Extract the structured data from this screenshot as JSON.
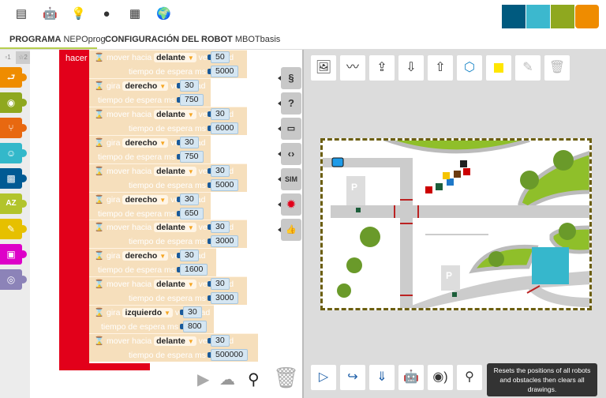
{
  "header": {
    "icons": [
      "program-list-icon",
      "robot-icon",
      "bulb-icon",
      "user-icon",
      "gallery-icon",
      "globe-icon"
    ],
    "logo_text": "NEPO",
    "logo_colors": [
      "#005a7f",
      "#3cb8ce",
      "#8fa81f",
      "#ef8c00"
    ]
  },
  "tabs": [
    {
      "bold": "PROGRAMA",
      "name": "NEPOprog"
    },
    {
      "bold": "CONFIGURACIÓN DEL ROBOT",
      "name": "MBOTbasis"
    }
  ],
  "palette": {
    "levels": [
      "1",
      "2"
    ],
    "categories": [
      {
        "name": "action",
        "color": "#ef8c00"
      },
      {
        "name": "sensors",
        "color": "#8fa81f"
      },
      {
        "name": "control",
        "color": "#e86810"
      },
      {
        "name": "logic",
        "color": "#33b8ca"
      },
      {
        "name": "math",
        "color": "#005a94"
      },
      {
        "name": "text",
        "color": "#b2c42c"
      },
      {
        "name": "colours",
        "color": "#e6c000"
      },
      {
        "name": "images",
        "color": "#dd00c8"
      },
      {
        "name": "communication",
        "color": "#8c83b8"
      }
    ]
  },
  "program": {
    "hacer": "hacer",
    "blocks": [
      {
        "type": "mover",
        "verb": "mover",
        "dir_label": "hacia",
        "dir": "delante",
        "speed_label": "velocidad",
        "speed": "50",
        "wait_label": "tiempo de espera ms",
        "wait": "5000"
      },
      {
        "type": "gira",
        "verb": "gira",
        "dir": "derecho",
        "speed_label": "velocidad",
        "speed": "30",
        "wait_label": "tiempo de espera ms",
        "wait": "750"
      },
      {
        "type": "mover",
        "verb": "mover",
        "dir_label": "hacia",
        "dir": "delante",
        "speed_label": "velocidad",
        "speed": "30",
        "wait_label": "tiempo de espera ms",
        "wait": "6000"
      },
      {
        "type": "gira",
        "verb": "gira",
        "dir": "derecho",
        "speed_label": "velocidad",
        "speed": "30",
        "wait_label": "tiempo de espera ms",
        "wait": "750"
      },
      {
        "type": "mover",
        "verb": "mover",
        "dir_label": "hacia",
        "dir": "delante",
        "speed_label": "velocidad",
        "speed": "30",
        "wait_label": "tiempo de espera ms",
        "wait": "5000"
      },
      {
        "type": "gira",
        "verb": "gira",
        "dir": "derecho",
        "speed_label": "velocidad",
        "speed": "30",
        "wait_label": "tiempo de espera ms",
        "wait": "650"
      },
      {
        "type": "mover",
        "verb": "mover",
        "dir_label": "hacia",
        "dir": "delante",
        "speed_label": "velocidad",
        "speed": "30",
        "wait_label": "tiempo de espera ms",
        "wait": "3000"
      },
      {
        "type": "gira",
        "verb": "gira",
        "dir": "derecho",
        "speed_label": "velocidad",
        "speed": "30",
        "wait_label": "tiempo de espera ms",
        "wait": "1600"
      },
      {
        "type": "mover",
        "verb": "mover",
        "dir_label": "hacia",
        "dir": "delante",
        "speed_label": "velocidad",
        "speed": "30",
        "wait_label": "tiempo de espera ms",
        "wait": "3000"
      },
      {
        "type": "giraizq",
        "verb": "gira",
        "dir": "izquierdo",
        "speed_label": "velocidad",
        "speed": "30",
        "wait_label": "tiempo de espera ms",
        "wait": "800"
      },
      {
        "type": "mover",
        "verb": "mover",
        "dir_label": "hacia",
        "dir": "delante",
        "speed_label": "velocidad",
        "speed": "30",
        "wait_label": "tiempo de espera ms",
        "wait": "500000"
      }
    ]
  },
  "side_toolbar": [
    "§",
    "?",
    "▭",
    "‹›",
    "SIM",
    "✹",
    "👍"
  ],
  "sim": {
    "tooltip": "Resets the positions of all robots and obstacles then clears all drawings.",
    "accent": "#1e88c8"
  }
}
